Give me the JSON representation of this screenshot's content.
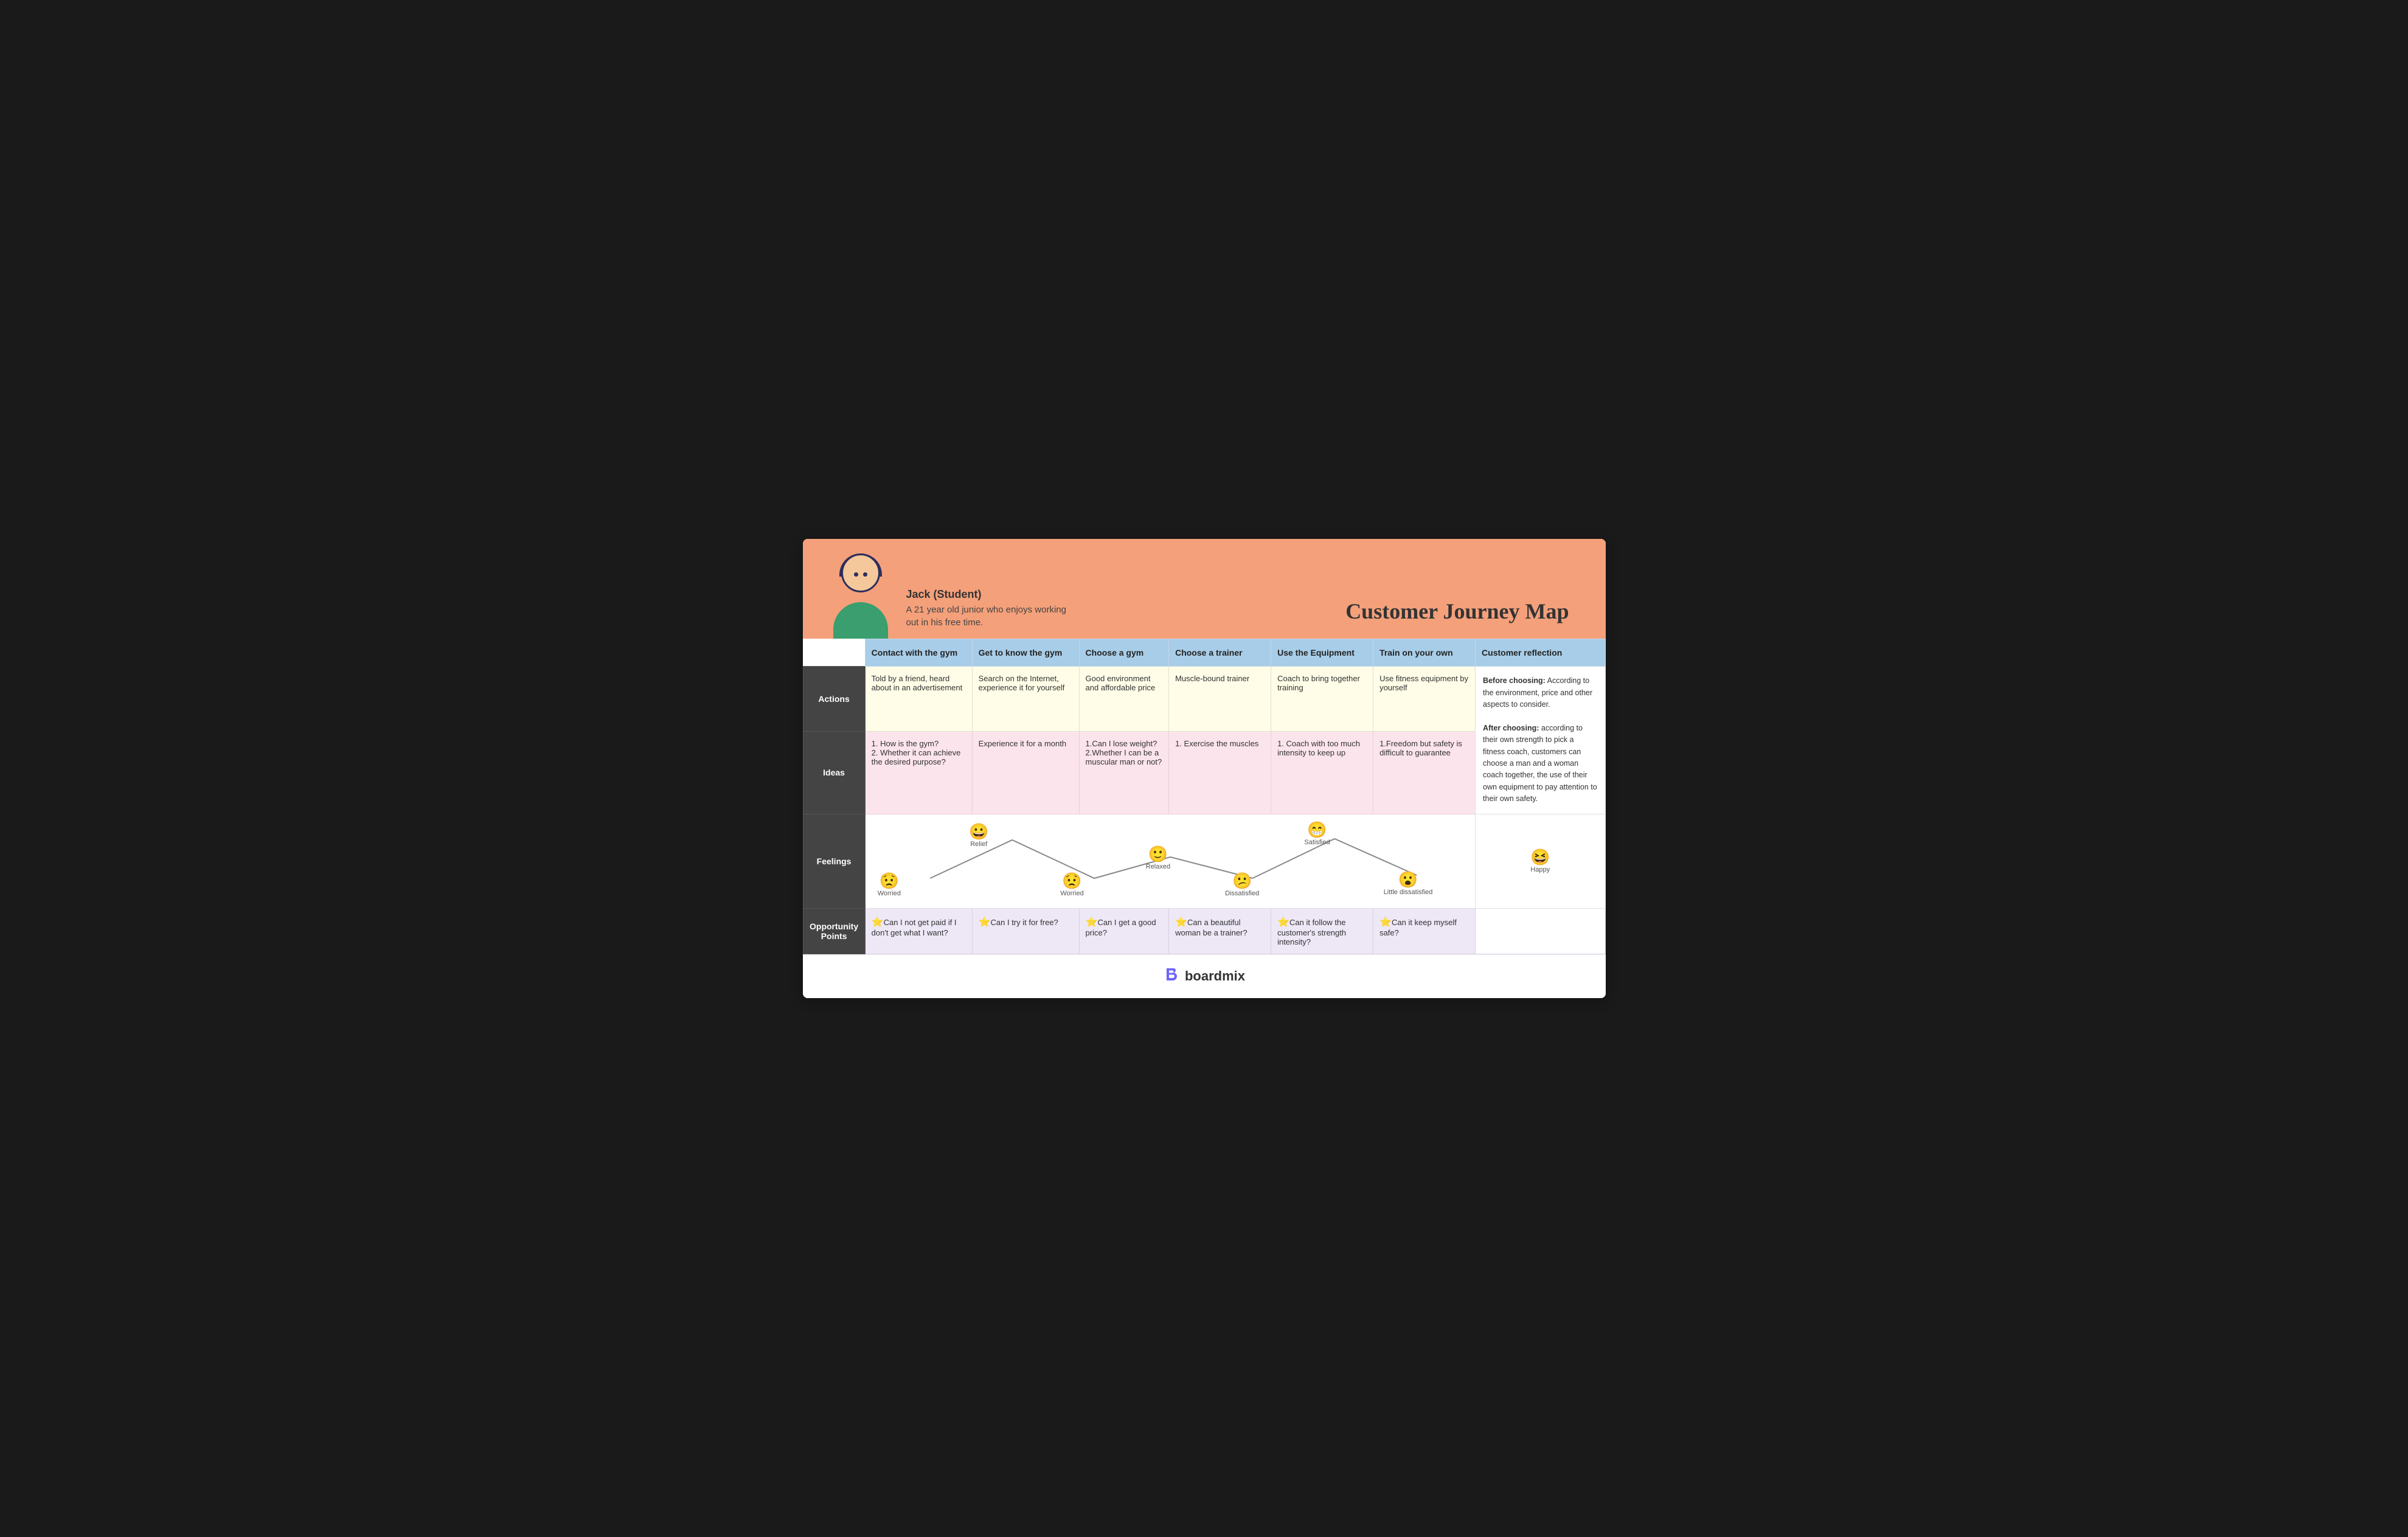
{
  "header": {
    "title": "Customer Journey Map",
    "persona_name": "Jack (Student)",
    "persona_desc": "A 21 year old junior who enjoys working\nout in his free time."
  },
  "columns": [
    {
      "id": "contact",
      "label": "Contact with the gym"
    },
    {
      "id": "know",
      "label": "Get to know the gym"
    },
    {
      "id": "choose_gym",
      "label": "Choose a gym"
    },
    {
      "id": "choose_trainer",
      "label": "Choose a trainer"
    },
    {
      "id": "equipment",
      "label": "Use the Equipment"
    },
    {
      "id": "train_own",
      "label": "Train on your own"
    },
    {
      "id": "reflection",
      "label": "Customer reflection"
    }
  ],
  "rows": {
    "actions": {
      "label": "Actions",
      "cells": [
        "Told by a friend, heard about in an advertisement",
        "Search on the Internet, experience it for yourself",
        "Good environment and affordable price",
        "Muscle-bound trainer",
        "Coach to bring together training",
        "Use fitness equipment by yourself",
        ""
      ]
    },
    "ideas": {
      "label": "Ideas",
      "cells": [
        "1. How is the gym?\n2. Whether it can achieve the desired purpose?",
        "Experience it for a month",
        "1.Can I lose weight?\n2.Whether I can be a muscular man or not?",
        "1. Exercise the muscles",
        "1. Coach with too much intensity to keep up",
        "1.Freedom but safety is difficult to guarantee",
        ""
      ]
    },
    "feelings": {
      "label": "Feelings",
      "points": [
        {
          "emoji": "😟",
          "label": "Worried",
          "level": 2
        },
        {
          "emoji": "😀",
          "label": "Relief",
          "level": 4
        },
        {
          "emoji": "😟",
          "label": "Worried",
          "level": 2
        },
        {
          "emoji": "🙂",
          "label": "Relaxed",
          "level": 3
        },
        {
          "emoji": "😕",
          "label": "Dissatisfied",
          "level": 2
        },
        {
          "emoji": "😁",
          "label": "Satisfied",
          "level": 4
        },
        {
          "emoji": "😮",
          "label": "Little dissatisfied",
          "level": 2
        },
        {
          "emoji": "😆",
          "label": "Happy",
          "level": 5
        }
      ]
    },
    "opportunity": {
      "label": "Opportunity Points",
      "cells": [
        "⭐Can I not get paid if I don't get what I want?",
        "⭐Can I try it for free?",
        "⭐Can I get a good price?",
        "⭐Can a beautiful woman be a trainer?",
        "⭐Can it follow the customer's strength intensity?",
        "⭐Can it keep myself safe?",
        ""
      ]
    }
  },
  "reflection_text": "Before choosing:\nAccording to the environment, price and other aspects to consider.\n\nAfter choosing:\naccording to their own strength to pick a fitness coach, customers can choose a man and a woman coach together, the use of their own equipment to pay attention to their own safety.",
  "footer": {
    "brand": "boardmix",
    "logo_char": "b"
  }
}
